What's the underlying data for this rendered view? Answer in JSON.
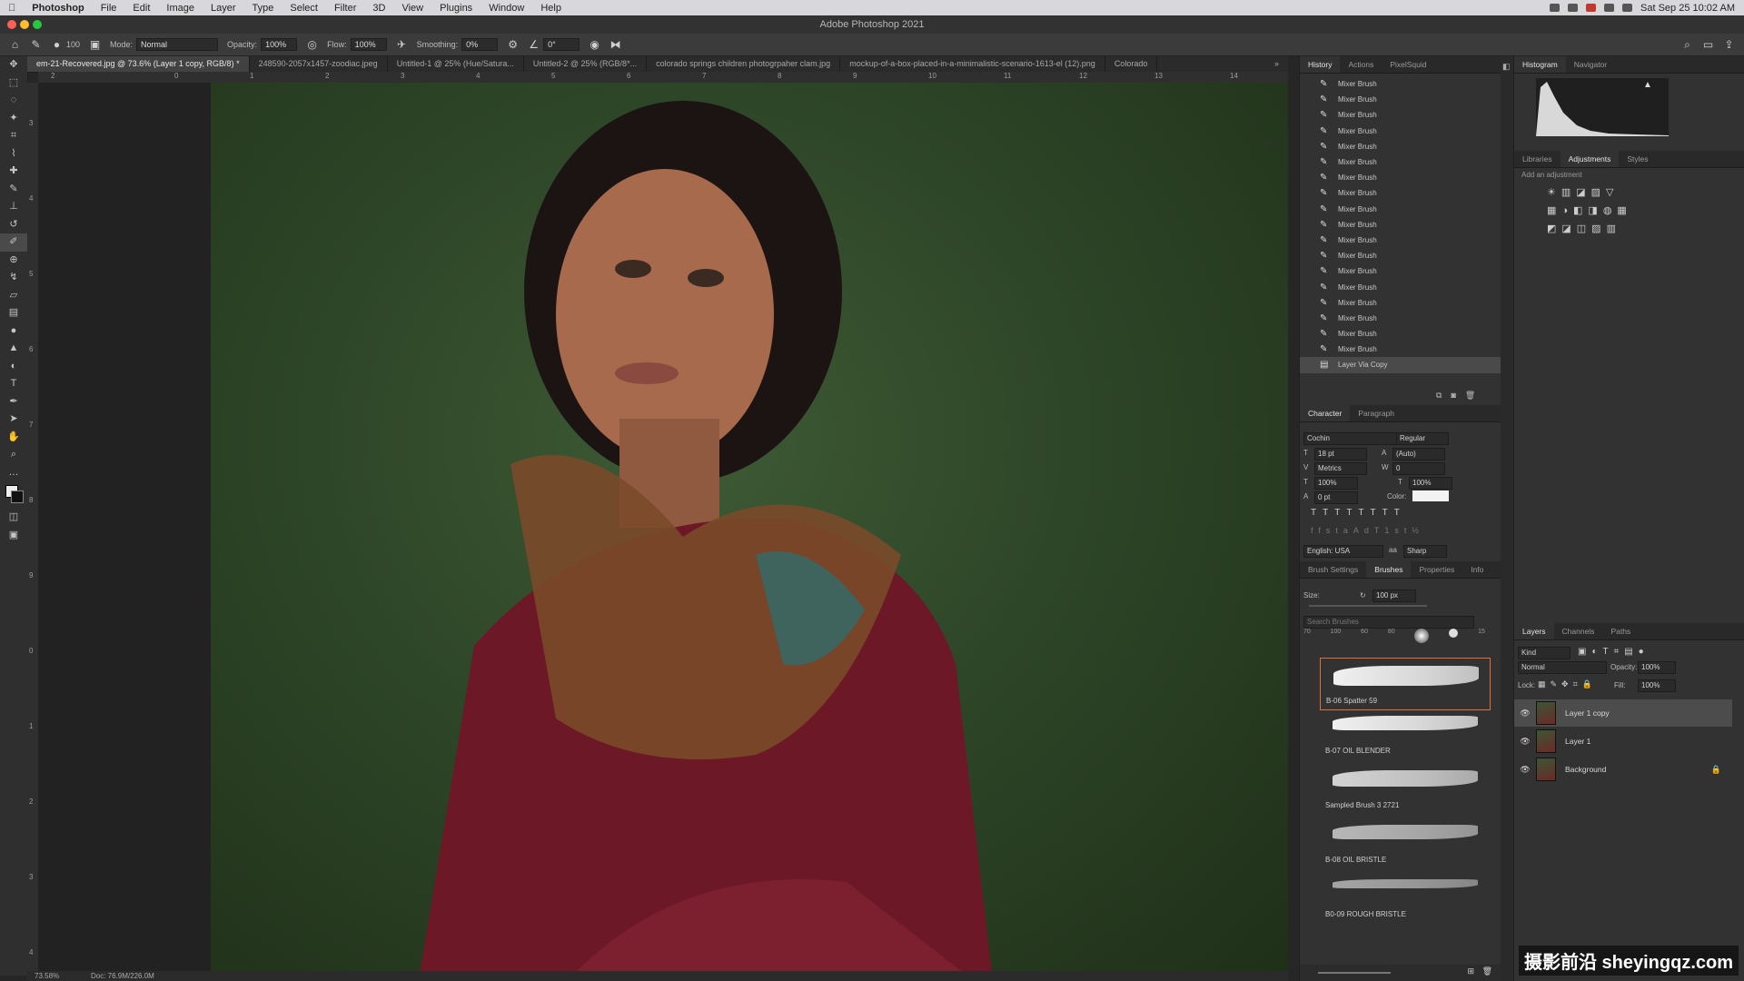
{
  "menubar": {
    "app": "Photoshop",
    "items": [
      "File",
      "Edit",
      "Image",
      "Layer",
      "Type",
      "Select",
      "Filter",
      "3D",
      "View",
      "Plugins",
      "Window",
      "Help"
    ],
    "clock": "Sat Sep 25  10:02 AM"
  },
  "window_title": "Adobe Photoshop 2021",
  "options_bar": {
    "brush_size": "100",
    "mode_label": "Mode:",
    "mode_value": "Normal",
    "opacity_label": "Opacity:",
    "opacity_value": "100%",
    "flow_label": "Flow:",
    "flow_value": "100%",
    "smoothing_label": "Smoothing:",
    "smoothing_value": "0%",
    "angle_value": "0°"
  },
  "doc_tabs": [
    "em-21-Recovered.jpg @ 73.6% (Layer 1 copy, RGB/8) *",
    "248590-2057x1457-zoodiac.jpeg",
    "Untitled-1 @ 25% (Hue/Satura...",
    "Untitled-2 @ 25% (RGB/8*...",
    "colorado springs children photogrpaher clam.jpg",
    "mockup-of-a-box-placed-in-a-minimalistic-scenario-1613-el (12).png",
    "Colorado"
  ],
  "ruler_h": [
    "2",
    "0",
    "1",
    "2",
    "3",
    "4",
    "5",
    "6",
    "7",
    "8",
    "9",
    "10",
    "11",
    "12",
    "13",
    "14"
  ],
  "ruler_v": [
    "3",
    "4",
    "5",
    "6",
    "7",
    "8",
    "9",
    "0",
    "1",
    "2",
    "3",
    "4"
  ],
  "status": {
    "zoom": "73.58%",
    "doc": "Doc: 76.9M/226.0M"
  },
  "history": {
    "tabs": [
      "History",
      "Actions",
      "PixelSquid"
    ],
    "items": [
      "Mixer Brush",
      "Mixer Brush",
      "Mixer Brush",
      "Mixer Brush",
      "Mixer Brush",
      "Mixer Brush",
      "Mixer Brush",
      "Mixer Brush",
      "Mixer Brush",
      "Mixer Brush",
      "Mixer Brush",
      "Mixer Brush",
      "Mixer Brush",
      "Mixer Brush",
      "Mixer Brush",
      "Mixer Brush",
      "Mixer Brush",
      "Mixer Brush"
    ],
    "selected_item": "Layer Via Copy"
  },
  "character": {
    "tabs": [
      "Character",
      "Paragraph"
    ],
    "font": "Cochin",
    "style": "Regular",
    "size": "18 pt",
    "leading": "(Auto)",
    "kerning": "Metrics",
    "tracking": "0",
    "vscale": "100%",
    "hscale": "100%",
    "baseline": "0 pt",
    "color_label": "Color:",
    "language": "English: USA",
    "aa_label": "aa",
    "antialias": "Sharp"
  },
  "brushes": {
    "tabs": [
      "Brush Settings",
      "Brushes",
      "Properties",
      "Info"
    ],
    "size_label": "Size:",
    "size_value": "100 px",
    "search_placeholder": "Search Brushes",
    "presets": [
      "70",
      "100",
      "60",
      "80",
      "",
      "",
      "15"
    ],
    "items": [
      "B-06 Spatter 59",
      "B-07 OIL BLENDER",
      "Sampled Brush 3 2721",
      "B-08 OIL BRISTLE",
      "B0-09 ROUGH  BRISTLE"
    ]
  },
  "histogram": {
    "tabs": [
      "Histogram",
      "Navigator"
    ]
  },
  "adjustments": {
    "tabs": [
      "Libraries",
      "Adjustments",
      "Styles"
    ],
    "add_label": "Add an adjustment"
  },
  "layers": {
    "tabs": [
      "Layers",
      "Channels",
      "Paths"
    ],
    "filter": "Kind",
    "blend_mode": "Normal",
    "opacity_label": "Opacity:",
    "opacity_value": "100%",
    "lock_label": "Lock:",
    "fill_label": "Fill:",
    "fill_value": "100%",
    "items": [
      {
        "name": "Layer 1 copy"
      },
      {
        "name": "Layer 1"
      },
      {
        "name": "Background"
      }
    ]
  },
  "watermark": "摄影前沿 sheyingqz.com"
}
